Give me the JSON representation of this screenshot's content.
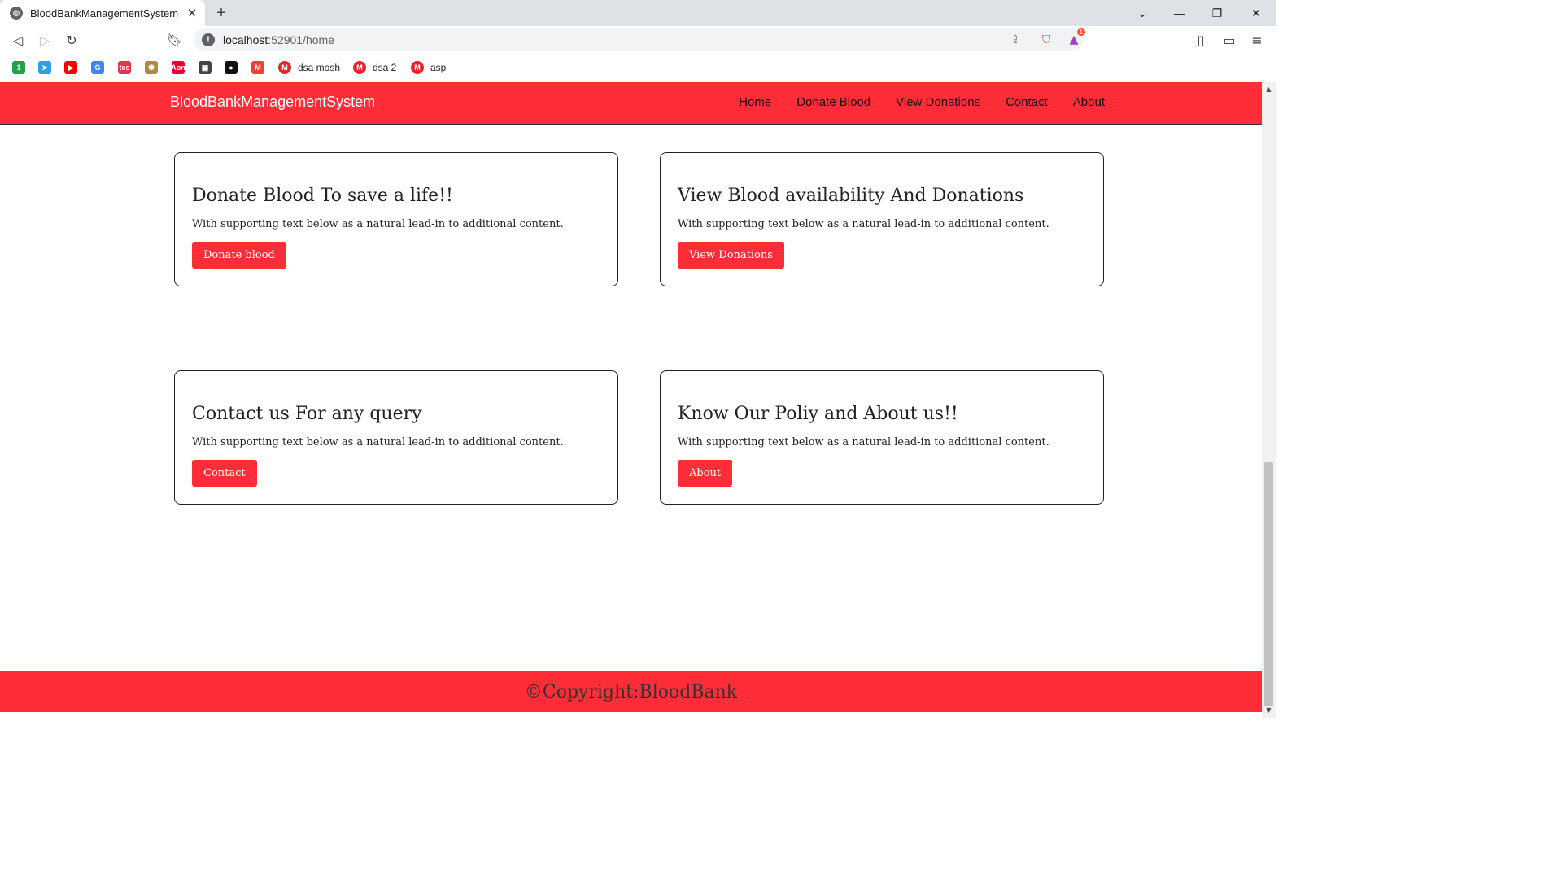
{
  "browser": {
    "tab_title": "BloodBankManagementSystem",
    "url_host": "localhost",
    "url_path": ":52901/home",
    "shields_badge": "1",
    "bookmarks": [
      {
        "label": "",
        "icon": "number-one-icon",
        "color": "#1ea446",
        "glyph": "1"
      },
      {
        "label": "",
        "icon": "telegram-icon",
        "color": "#2aa3e0",
        "glyph": "➤"
      },
      {
        "label": "",
        "icon": "youtube-icon",
        "color": "#ff0000",
        "glyph": "▶"
      },
      {
        "label": "",
        "icon": "google-icon",
        "color": "#4285f4",
        "glyph": "G"
      },
      {
        "label": "",
        "icon": "tcs-icon",
        "color": "#e3354b",
        "glyph": "tcs"
      },
      {
        "label": "",
        "icon": "emblem-icon",
        "color": "#b08a3e",
        "glyph": "✺"
      },
      {
        "label": "",
        "icon": "aon-icon",
        "color": "#e4002b",
        "glyph": "Aon"
      },
      {
        "label": "",
        "icon": "contact-card-icon",
        "color": "#444444",
        "glyph": "▣"
      },
      {
        "label": "",
        "icon": "github-icon",
        "color": "#111111",
        "glyph": "●"
      },
      {
        "label": "",
        "icon": "gmail-icon",
        "color": "#ea4335",
        "glyph": "M"
      },
      {
        "label": "dsa mosh",
        "icon": "mosh-icon",
        "color": "#e2262c",
        "glyph": "M"
      },
      {
        "label": "dsa 2",
        "icon": "mosh-icon",
        "color": "#e2262c",
        "glyph": "M"
      },
      {
        "label": "asp",
        "icon": "mosh-icon",
        "color": "#e2262c",
        "glyph": "M"
      }
    ]
  },
  "navbar": {
    "brand": "BloodBankManagementSystem",
    "links": [
      "Home",
      "Donate Blood",
      "View Donations",
      "Contact",
      "About"
    ]
  },
  "cards": [
    {
      "title": "Donate Blood To save a life!!",
      "text": "With supporting text below as a natural lead-in to additional content.",
      "button": "Donate blood"
    },
    {
      "title": "View Blood availability And Donations",
      "text": "With supporting text below as a natural lead-in to additional content.",
      "button": "View Donations"
    },
    {
      "title": "Contact us For any query",
      "text": "With supporting text below as a natural lead-in to additional content.",
      "button": "Contact"
    },
    {
      "title": "Know Our Poliy and About us!!",
      "text": "With supporting text below as a natural lead-in to additional content.",
      "button": "About"
    }
  ],
  "footer": {
    "text": "©Copyright:BloodBank"
  },
  "colors": {
    "brand_red": "#fe2d37",
    "footer_text": "#333333"
  }
}
